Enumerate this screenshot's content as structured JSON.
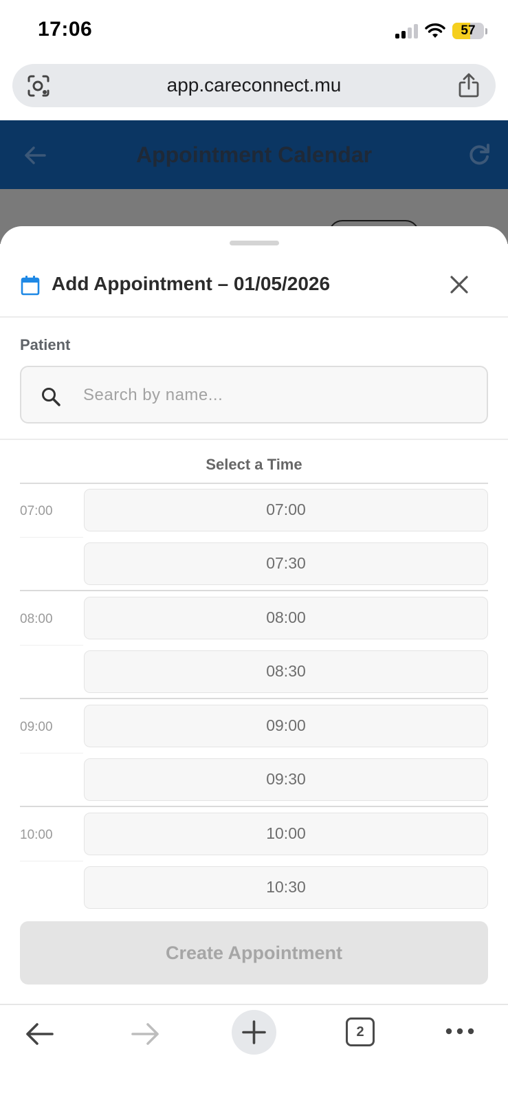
{
  "status_bar": {
    "time": "17:06",
    "battery": "57",
    "battery_level": 0.57
  },
  "browser": {
    "url": "app.careconnect.mu",
    "tab_count": "2"
  },
  "app_header": {
    "title": "Appointment Calendar"
  },
  "sheet": {
    "title": "Add Appointment – 01/05/2026",
    "patient_label": "Patient",
    "search_placeholder": "Search by name...",
    "time_heading": "Select a Time",
    "hours": [
      {
        "label": "07:00",
        "slots": [
          "07:00",
          "07:30"
        ]
      },
      {
        "label": "08:00",
        "slots": [
          "08:00",
          "08:30"
        ]
      },
      {
        "label": "09:00",
        "slots": [
          "09:00",
          "09:30"
        ]
      },
      {
        "label": "10:00",
        "slots": [
          "10:00",
          "10:30"
        ]
      }
    ],
    "create_button": "Create Appointment"
  },
  "colors": {
    "header_bg": "#0b3663",
    "calendar_icon": "#1e88e5",
    "battery_fill": "#f5cf1e",
    "disabled_button": "#e4e4e4"
  },
  "icons": [
    "signal-icon",
    "wifi-icon",
    "battery-icon",
    "lens-icon",
    "share-icon",
    "back-arrow-icon",
    "refresh-icon",
    "calendar-icon",
    "close-icon",
    "search-icon",
    "forward-arrow-icon",
    "plus-icon",
    "tabs-icon",
    "more-icon"
  ]
}
